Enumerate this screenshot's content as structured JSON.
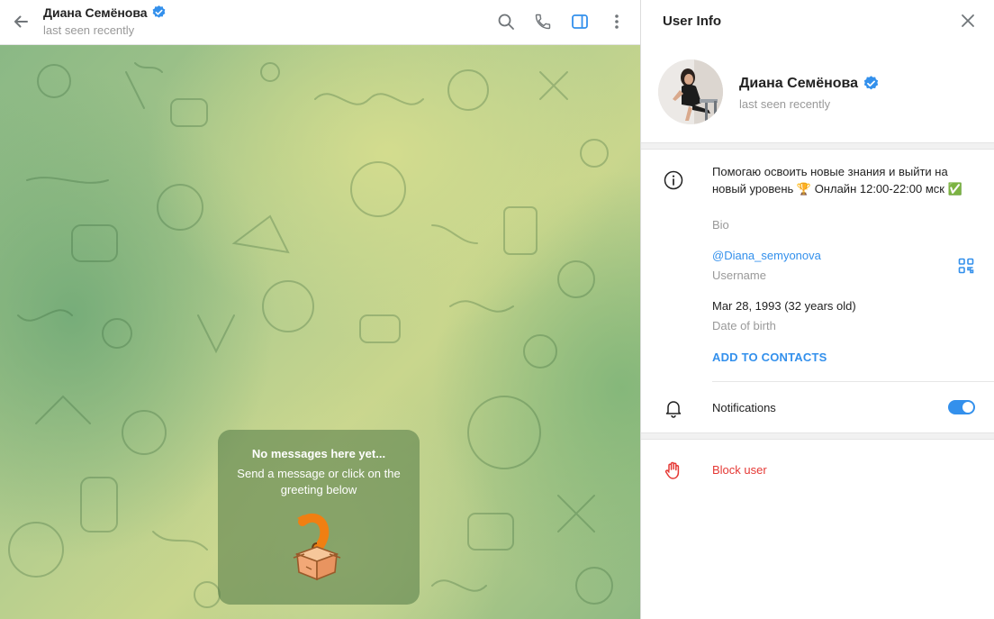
{
  "chat_header": {
    "peer_name": "Диана Семёнова",
    "peer_status": "last seen recently",
    "icons": [
      "back-arrow-icon",
      "search-icon",
      "phone-icon",
      "sidebar-toggle-icon",
      "more-vertical-icon"
    ]
  },
  "empty_state": {
    "title": "No messages here yet...",
    "subtitle": "Send a message or click on the greeting below"
  },
  "info_panel": {
    "title": "User Info",
    "name": "Диана Семёнова",
    "status": "last seen recently",
    "bio": "Помогаю освоить новые знания и выйти на новый уровень 🏆 Онлайн 12:00-22:00 мск ✅",
    "bio_caption": "Bio",
    "username": "@Diana_semyonova",
    "username_caption": "Username",
    "dob": "Mar 28, 1993 (32 years old)",
    "dob_caption": "Date of birth",
    "add_contacts": "ADD TO CONTACTS",
    "notifications_label": "Notifications",
    "notifications_on": true,
    "block_label": "Block user"
  },
  "colors": {
    "accent": "#3390ec",
    "danger": "#e53935",
    "verified": "#3390ec",
    "muted_text": "#999999"
  }
}
